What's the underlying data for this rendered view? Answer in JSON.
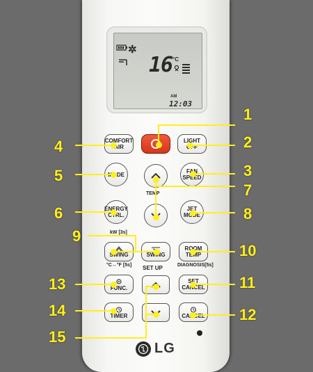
{
  "lcd": {
    "temperature": "16",
    "unit": "°C",
    "clock_period": "AM",
    "clock": "12:03",
    "mode_icon": "snowflake-icon",
    "battery_icon": "battery-icon",
    "fan_icon": "fan-level-icon"
  },
  "buttons": {
    "comfort_air": [
      "COMFORT",
      "AIR"
    ],
    "light_off": [
      "LIGHT",
      "OFF"
    ],
    "mode": "MODE",
    "fan_speed": [
      "FAN",
      "SPEED"
    ],
    "energy_ctrl": [
      "ENERGY",
      "CTRL."
    ],
    "jet_mode": [
      "JET",
      "MODE"
    ],
    "swing_left": "SWING",
    "swing_right": "SWING",
    "room_temp": [
      "ROOM",
      "TEMP"
    ],
    "func": "FUNC.",
    "set_cancel": [
      "SET",
      "CANCEL"
    ],
    "timer": "TIMER",
    "cancel": "CANCEL"
  },
  "labels": {
    "temp": "TEMP",
    "energy_sub": "kW [3s]",
    "swing_sub": "°C↔°F [5s]",
    "room_sub": "DIAGNOSIS[5s]",
    "setup": "SET UP"
  },
  "callouts": [
    "1",
    "2",
    "3",
    "4",
    "5",
    "6",
    "7",
    "8",
    "9",
    "10",
    "11",
    "12",
    "13",
    "14",
    "15"
  ],
  "brand": "LG",
  "colors": {
    "power": "#e0401f",
    "callout": "#ffef1a",
    "background": "#6b6b6b"
  }
}
